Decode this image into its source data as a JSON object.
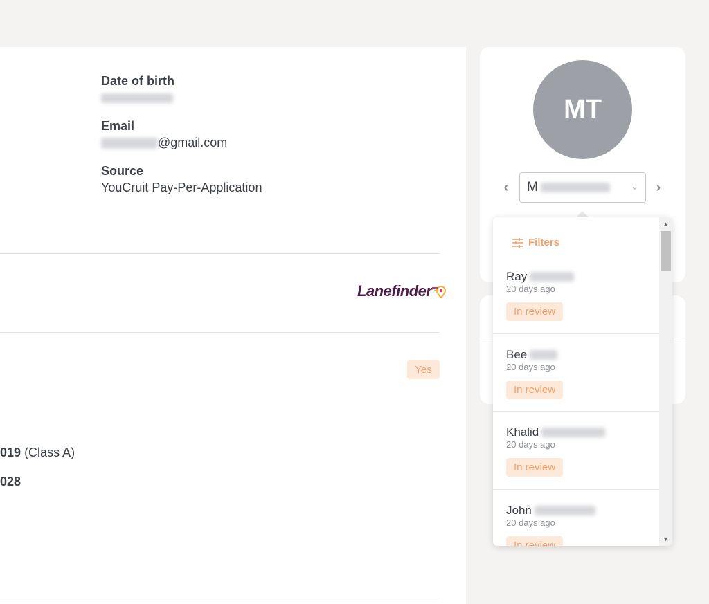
{
  "profile": {
    "fields": [
      {
        "label": "Date of birth",
        "value_prefix": "",
        "value_suffix": ""
      },
      {
        "label": "Email",
        "value_prefix": "",
        "value_suffix": "@gmail.com"
      },
      {
        "label": "Source",
        "value_prefix": "YouCruit Pay-Per-Application",
        "value_suffix": ""
      }
    ],
    "company_logo": "Lanefinder",
    "yes_badge": "Yes",
    "license_year": "019",
    "license_class": "(Class A)",
    "license_expiry": "028"
  },
  "sidebar": {
    "avatar_initials": "MT",
    "selected_candidate_initial": "M",
    "prev_icon": "chevron-left-icon",
    "next_icon": "chevron-right-icon"
  },
  "dropdown": {
    "filters_label": "Filters",
    "items": [
      {
        "first_name": "Ray",
        "time": "20 days ago",
        "status": "In review"
      },
      {
        "first_name": "Bee",
        "time": "20 days ago",
        "status": "In review"
      },
      {
        "first_name": "Khalid",
        "time": "20 days ago",
        "status": "In review"
      },
      {
        "first_name": "John",
        "time": "20 days ago",
        "status": "In review"
      }
    ]
  },
  "colors": {
    "accent": "#f0a06a",
    "badge_bg": "#fde9da",
    "avatar_bg": "#9da1a7"
  }
}
